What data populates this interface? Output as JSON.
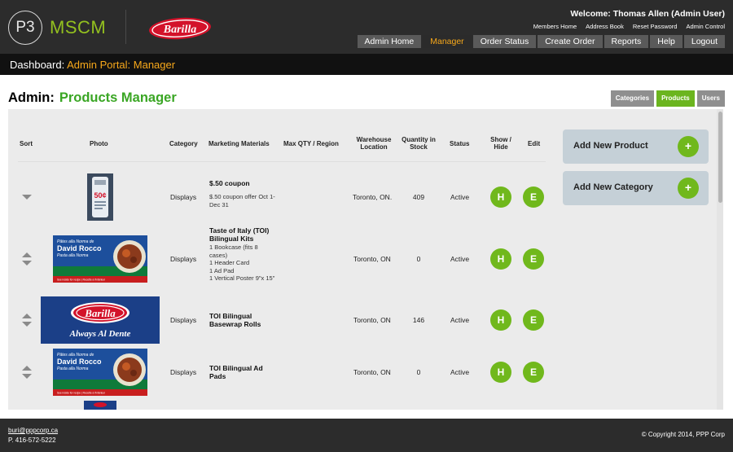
{
  "brand": {
    "logo_mark": "P3",
    "logo_text": "MSCM",
    "client_logo": "Barilla"
  },
  "header": {
    "welcome": "Welcome: Thomas Allen (Admin User)",
    "top_links": [
      "Members Home",
      "Address Book",
      "Reset Password",
      "Admin Control"
    ],
    "nav": [
      {
        "label": "Admin Home",
        "active": false
      },
      {
        "label": "Manager",
        "active": true
      },
      {
        "label": "Order Status",
        "active": false
      },
      {
        "label": "Create Order",
        "active": false
      },
      {
        "label": "Reports",
        "active": false
      },
      {
        "label": "Help",
        "active": false
      },
      {
        "label": "Logout",
        "active": false
      }
    ]
  },
  "breadcrumb": {
    "label": "Dashboard:",
    "value": "Admin Portal: Manager"
  },
  "page": {
    "title_prefix": "Admin:",
    "title": "Products Manager",
    "subtabs": [
      {
        "label": "Categories",
        "active": false
      },
      {
        "label": "Products",
        "active": true
      },
      {
        "label": "Users",
        "active": false
      }
    ]
  },
  "table": {
    "headers": {
      "sort": "Sort",
      "photo": "Photo",
      "category": "Category",
      "marketing": "Marketing Materials",
      "max_qty": "Max QTY / Region",
      "warehouse": "Warehouse Location",
      "quantity": "Quantity in Stock",
      "status": "Status",
      "show_hide": "Show / Hide",
      "edit": "Edit"
    },
    "hide_label": "H",
    "edit_label": "E",
    "rows": [
      {
        "photo": "coupon-photo",
        "photo_text": "50¢",
        "category": "Displays",
        "name": "$.50 coupon",
        "description": "$.50 coupon offer Oct 1-\nDec 31",
        "max_qty": "",
        "warehouse": "Toronto, ON.",
        "quantity": "409",
        "status": "Active"
      },
      {
        "photo": "banner-photo",
        "category": "Displays",
        "name": "Taste of Italy (TOI)\nBilingual Kits",
        "description": "1 Bookcase (fits 8\ncases)\n1 Header Card\n1 Ad Pad\n1 Vertical Poster 9\"x 15\"",
        "max_qty": "",
        "warehouse": "Toronto, ON",
        "quantity": "0",
        "status": "Active"
      },
      {
        "photo": "basewrap-photo",
        "photo_text": "Always Al Dente",
        "category": "Displays",
        "name": "TOI Bilingual\nBasewrap Rolls",
        "description": "",
        "max_qty": "",
        "warehouse": "Toronto, ON",
        "quantity": "146",
        "status": "Active"
      },
      {
        "photo": "banner-photo",
        "category": "Displays",
        "name": "TOI Bilingual Ad\nPads",
        "description": "",
        "max_qty": "",
        "warehouse": "Toronto, ON",
        "quantity": "0",
        "status": "Active"
      }
    ]
  },
  "banner": {
    "line1": "Pâtes alla Norma de",
    "line2": "David Rocco",
    "line3": "Pasta alla Norma",
    "foot": "See inside for recipe | Recette à l'intérieur"
  },
  "sidebar": {
    "add_product": "Add New Product",
    "add_category": "Add New Category",
    "plus": "+"
  },
  "footer": {
    "email": "buri@pppcorp.ca",
    "phone": "P. 416-572-5222",
    "copyright": "© Copyright 2014, PPP Corp"
  },
  "colors": {
    "accent_green": "#70b81c",
    "title_green": "#3aa624",
    "accent_orange": "#f7a81b",
    "header_bg": "#2c2c2c"
  }
}
